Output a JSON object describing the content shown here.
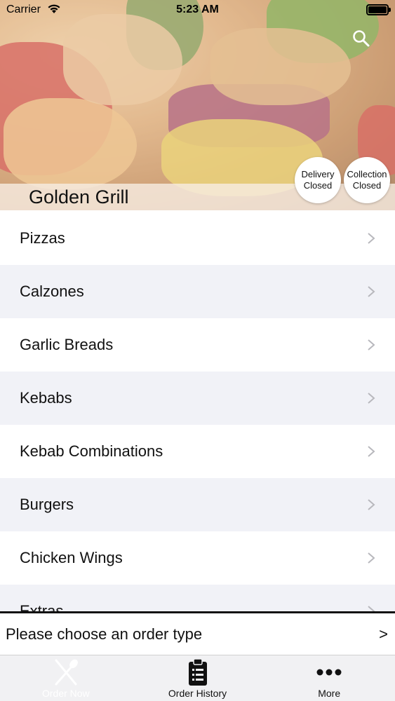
{
  "status_bar": {
    "carrier": "Carrier",
    "time": "5:23 AM"
  },
  "restaurant": {
    "name": "Golden Grill"
  },
  "badges": {
    "delivery": {
      "line1": "Delivery",
      "line2": "Closed"
    },
    "collection": {
      "line1": "Collection",
      "line2": "Closed"
    }
  },
  "menu": {
    "categories": [
      "Pizzas",
      "Calzones",
      "Garlic Breads",
      "Kebabs",
      "Kebab Combinations",
      "Burgers",
      "Chicken Wings",
      "Extras"
    ]
  },
  "order_bar": {
    "label": "Please choose an order type",
    "arrow": ">"
  },
  "tabs": [
    {
      "label": "Order Now",
      "icon": "fork-knife-icon",
      "active": true
    },
    {
      "label": "Order History",
      "icon": "clipboard-list-icon",
      "active": false
    },
    {
      "label": "More",
      "icon": "more-dots-icon",
      "active": false
    }
  ],
  "colors": {
    "row_alt": "#f1f2f7",
    "tab_bar": "#f1f1f3",
    "active_tab": "#ffffff"
  }
}
